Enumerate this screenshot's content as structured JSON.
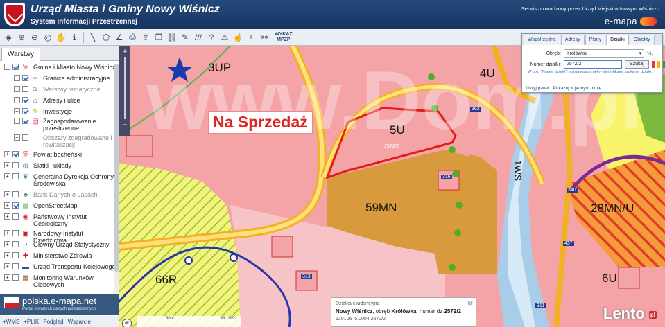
{
  "header": {
    "title": "Urząd Miasta i Gminy Nowy Wiśnicz",
    "subtitle": "System Informacji Przestrzennej",
    "service_note": "Serwis prowadzony przez Urząd Miejski w Nowym Wiśniczu",
    "brand": "e-mapa"
  },
  "toolbar": {
    "wykaz_label": "WYKAZ",
    "mpzp_label": "MPZP"
  },
  "layers_panel": {
    "tab_label": "Warstwy",
    "items": [
      {
        "label": "Gmina i Miasto Nowy Wiśnicz",
        "checked": true,
        "expander": "−",
        "icon": "crest-icon"
      },
      {
        "label": "Granice administracyjne",
        "checked": true,
        "expander": "+",
        "icon": "dashed-line-icon"
      },
      {
        "label": "Warstwy tematyczne",
        "checked": false,
        "expander": "+",
        "icon": "layers-icon",
        "grey": true
      },
      {
        "label": "Adresy i ulice",
        "checked": true,
        "expander": "+",
        "icon": "address-icon"
      },
      {
        "label": "Inwestycje",
        "checked": true,
        "expander": "+",
        "icon": "pencil-icon"
      },
      {
        "label": "Zagospodarowanie przestrzenne",
        "checked": true,
        "expander": "+",
        "icon": "planning-icon"
      },
      {
        "label": "Obszary zdegradowane i rewitalizacji",
        "checked": false,
        "expander": "+",
        "icon": "",
        "grey": true
      },
      {
        "label": "Powiat bocheński",
        "checked": true,
        "expander": "+",
        "icon": "powiat-crest-icon"
      },
      {
        "label": "Siatki i układy",
        "checked": false,
        "expander": "+",
        "icon": "globe-icon"
      },
      {
        "label": "Generalna Dyrekcja Ochrony Środowiska",
        "checked": false,
        "expander": "+",
        "icon": "gdos-icon"
      },
      {
        "label": "Bank Danych o Lasach",
        "checked": false,
        "expander": "+",
        "icon": "tree-icon",
        "grey": true
      },
      {
        "label": "OpenStreetMap",
        "checked": true,
        "expander": "+",
        "icon": "osm-icon"
      },
      {
        "label": "Państwowy Instytut Geologiczny",
        "checked": false,
        "expander": "+",
        "icon": "pig-icon"
      },
      {
        "label": "Narodowy Instytut Dziedzictwa",
        "checked": false,
        "expander": "+",
        "icon": "nid-icon"
      },
      {
        "label": "Główny Urząd Statystyczny",
        "checked": false,
        "expander": "+",
        "icon": "gus-icon"
      },
      {
        "label": "Ministerstwo Zdrowia",
        "checked": false,
        "expander": "+",
        "icon": "health-icon"
      },
      {
        "label": "Urząd Transportu Kolejowego",
        "checked": false,
        "expander": "+",
        "icon": "rail-icon"
      },
      {
        "label": "Monitoring Warunków Glebowych",
        "checked": false,
        "expander": "+",
        "icon": "soil-icon"
      }
    ]
  },
  "promo": {
    "title": "polska.e-mapa.net",
    "subtitle": "Portal otwartych danych przestrzennych"
  },
  "footer": {
    "links": [
      "+WMS",
      "+PLIK",
      "Podgląd",
      "Wsparcie"
    ]
  },
  "map": {
    "zones": [
      "3UP",
      "4U",
      "5U",
      "59MN",
      "28MN/U",
      "66R",
      "6U",
      "1WS"
    ],
    "sale_banner": "Na Sprzedaż",
    "parcels": [
      "2572/2",
      "316",
      "362",
      "313",
      "340",
      "437",
      "311"
    ],
    "scale_label": "30m",
    "crs_label": "PL-1992",
    "watermark": "www.Dom.pl",
    "ok_label": "ok"
  },
  "popup": {
    "title": "Działka ewidencyjna",
    "line1_prefix": "Nowy Wiśnicz",
    "line1_mid": ", obręb ",
    "line1_obreb": "Królówka",
    "line1_num_prefix": ", numer dz ",
    "line1_num": "2572/2",
    "line2": "120106_5.0004.2572/2"
  },
  "watermark_brand": {
    "name": "Lento",
    "tld": "pl"
  },
  "search_widget": {
    "tabs": [
      "Współrzędne",
      "Adresy",
      "Plany",
      "Działki",
      "Obiekty"
    ],
    "active_tab": "Działki",
    "obreb_label": "Obręb:",
    "obreb_value": "Królówka",
    "number_label": "Numer działki:",
    "number_value": "2572/2",
    "search_button": "Szukaj",
    "hint": "W polu \"Numer działki\" można wpisać pełny identyfikator szukanej działki.",
    "footer_links": [
      "Ukryj panel",
      "Pokazuj w jednym oknie"
    ]
  }
}
